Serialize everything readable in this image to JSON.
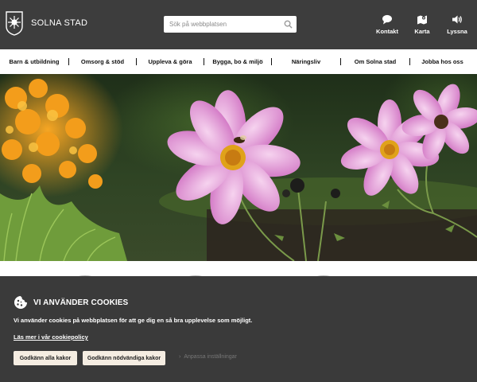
{
  "header": {
    "logo_text": "SOLNA STAD",
    "search_placeholder": "Sök på webbplatsen",
    "tools": [
      {
        "label": "Kontakt",
        "icon": "chat-icon"
      },
      {
        "label": "Karta",
        "icon": "map-icon"
      },
      {
        "label": "Lyssna",
        "icon": "speaker-icon"
      }
    ]
  },
  "nav": {
    "items": [
      "Barn & utbildning",
      "Omsorg & stöd",
      "Uppleva & göra",
      "Bygga, bo & miljö",
      "Näringsliv",
      "Om Solna stad",
      "Jobba hos oss"
    ]
  },
  "hero": {
    "subject": "Pink cosmos flowers with a bee"
  },
  "cookie": {
    "title": "VI ANVÄNDER COOKIES",
    "text": "Vi använder cookies på webbplatsen för att ge dig en så bra upplevelse som möjligt.",
    "policy_link": "Läs mer i vår cookiepolicy",
    "accept_all": "Godkänn alla kakor",
    "accept_necessary": "Godkänn nödvändiga kakor",
    "settings": "Anpassa inställningar"
  },
  "colors": {
    "header_bg": "#3d3d3d",
    "banner_bg": "#3a3a3a",
    "button_bg": "#f5ede2"
  }
}
